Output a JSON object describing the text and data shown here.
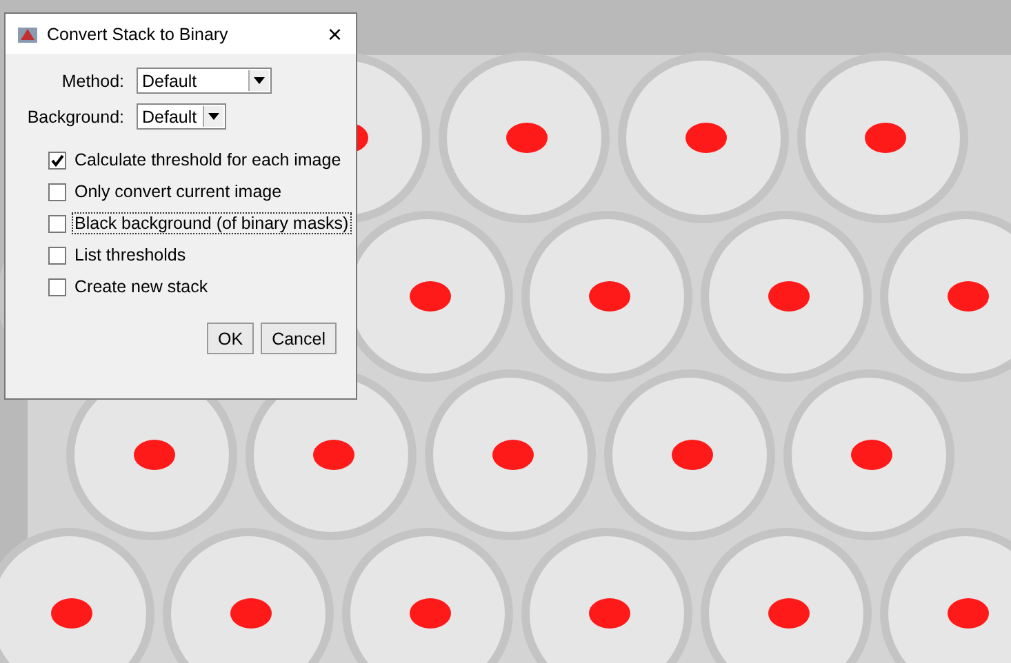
{
  "window": {
    "title": "Convert Stack to Binary",
    "close": "×"
  },
  "fields": [
    {
      "label": "Method:",
      "value": "Default"
    },
    {
      "label": "Background:",
      "value": "Default"
    }
  ],
  "options": [
    {
      "label": "Calculate threshold for each image",
      "checked": true,
      "focused": false
    },
    {
      "label": "Only convert current image",
      "checked": false,
      "focused": false
    },
    {
      "label": "Black background (of binary masks)",
      "checked": false,
      "focused": true
    },
    {
      "label": "List thresholds",
      "checked": false,
      "focused": false
    },
    {
      "label": "Create new stack",
      "checked": false,
      "focused": false
    }
  ],
  "buttons": [
    "OK",
    "Cancel"
  ]
}
